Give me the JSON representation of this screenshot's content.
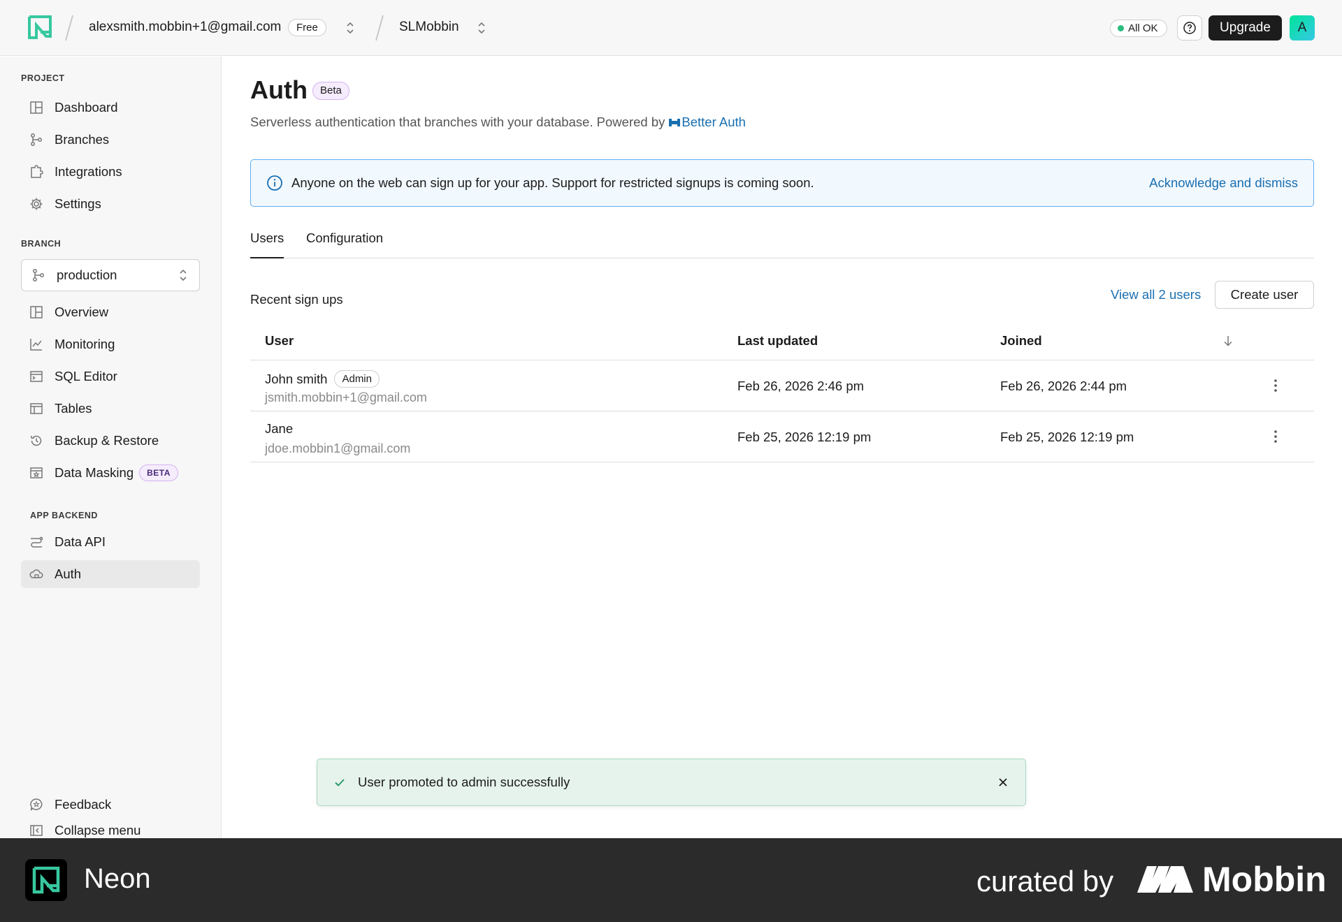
{
  "header": {
    "account_email": "alexsmith.mobbin+1@gmail.com",
    "plan_badge": "Free",
    "project_name": "SLMobbin",
    "status_label": "All OK",
    "upgrade_label": "Upgrade",
    "avatar_initial": "A"
  },
  "sidebar": {
    "project_section": "PROJECT",
    "project_items": [
      {
        "label": "Dashboard",
        "icon": "dashboard-icon"
      },
      {
        "label": "Branches",
        "icon": "branch-icon"
      },
      {
        "label": "Integrations",
        "icon": "puzzle-icon"
      },
      {
        "label": "Settings",
        "icon": "gear-icon"
      }
    ],
    "branch_section": "BRANCH",
    "branch_selected": "production",
    "branch_items": [
      {
        "label": "Overview",
        "icon": "grid-icon"
      },
      {
        "label": "Monitoring",
        "icon": "chart-icon"
      },
      {
        "label": "SQL Editor",
        "icon": "terminal-icon"
      },
      {
        "label": "Tables",
        "icon": "table-icon"
      },
      {
        "label": "Backup & Restore",
        "icon": "history-icon"
      },
      {
        "label": "Data Masking",
        "icon": "mask-icon",
        "badge": "BETA"
      }
    ],
    "app_backend_section": "APP BACKEND",
    "app_backend_items": [
      {
        "label": "Data API",
        "icon": "api-icon"
      },
      {
        "label": "Auth",
        "icon": "cloud-lock-icon",
        "active": true
      }
    ],
    "feedback_label": "Feedback",
    "collapse_label": "Collapse menu"
  },
  "main": {
    "title": "Auth",
    "title_badge": "Beta",
    "subtitle": "Serverless authentication that branches with your database. Powered by",
    "powered_by": "Better Auth",
    "banner": {
      "text": "Anyone on the web can sign up for your app. Support for restricted signups is coming soon.",
      "action": "Acknowledge and dismiss"
    },
    "tabs": [
      {
        "label": "Users",
        "active": true
      },
      {
        "label": "Configuration",
        "active": false
      }
    ],
    "recent_label": "Recent sign ups",
    "view_all_label": "View all 2 users",
    "create_user_label": "Create user",
    "table": {
      "columns": [
        "User",
        "Last updated",
        "Joined"
      ],
      "rows": [
        {
          "name": "John smith",
          "badge": "Admin",
          "email": "jsmith.mobbin+1@gmail.com",
          "last_updated": "Feb 26, 2026 2:46 pm",
          "joined": "Feb 26, 2026 2:44 pm"
        },
        {
          "name": "Jane",
          "badge": "",
          "email": "jdoe.mobbin1@gmail.com",
          "last_updated": "Feb 25, 2026 12:19 pm",
          "joined": "Feb 25, 2026 12:19 pm"
        }
      ]
    }
  },
  "toast": {
    "text": "User promoted to admin successfully"
  },
  "footer": {
    "app_name": "Neon",
    "curated_by": "curated by",
    "brand": "Mobbin"
  },
  "colors": {
    "accent_green": "#00e599",
    "link_blue": "#1a6fb0",
    "status_green": "#2bbd7e"
  }
}
